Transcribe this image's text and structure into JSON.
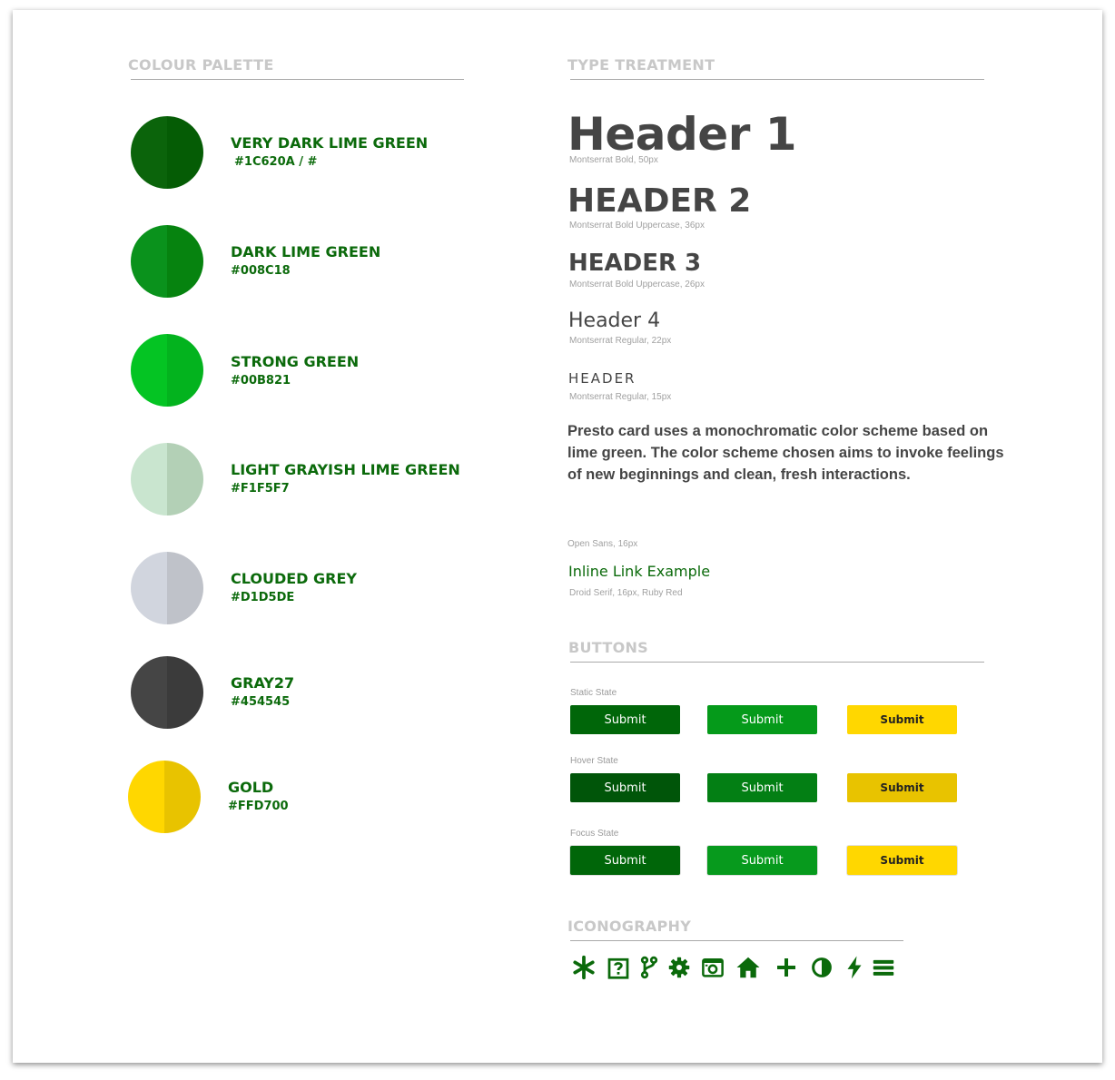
{
  "palette": {
    "title": "COLOUR PALETTE",
    "swatches": [
      {
        "name": "VERY DARK LIME GREEN",
        "hex": "#1C620A / #",
        "color_left": "#0b640b",
        "color_right": "#055c05"
      },
      {
        "name": "DARK LIME GREEN",
        "hex": "#008C18",
        "color_left": "#0a921c",
        "color_right": "#06830f"
      },
      {
        "name": "STRONG GREEN",
        "hex": "#00B821",
        "color_left": "#04c423",
        "color_right": "#03b31e"
      },
      {
        "name": "LIGHT GRAYISH LIME GREEN",
        "hex": "#F1F5F7",
        "color_left": "#c9e5cf",
        "color_right": "#b3d0b6"
      },
      {
        "name": "CLOUDED GREY",
        "hex": "#D1D5DE",
        "color_left": "#d1d5de",
        "color_right": "#bfc2c9"
      },
      {
        "name": "GRAY27",
        "hex": "#454545",
        "color_left": "#454545",
        "color_right": "#3b3b3b"
      },
      {
        "name": "GOLD",
        "hex": "#FFD700",
        "color_left": "#ffd700",
        "color_right": "#e8c300"
      }
    ]
  },
  "type": {
    "title": "TYPE TREATMENT",
    "h1": {
      "sample": "Header 1",
      "caption": "Montserrat Bold, 50px"
    },
    "h2": {
      "sample": "HEADER 2",
      "caption": "Montserrat Bold Uppercase, 36px"
    },
    "h3": {
      "sample": "HEADER 3",
      "caption": "Montserrat Bold Uppercase, 26px"
    },
    "h4": {
      "sample": "Header 4",
      "caption": "Montserrat Regular, 22px"
    },
    "h5": {
      "sample": "HEADER",
      "caption": "Montserrat Regular, 15px"
    },
    "paragraph": "Presto card uses a monochromatic color scheme based on lime green. The color scheme chosen aims to invoke feelings of new beginnings and clean, fresh interactions.",
    "paragraph_caption": "Open Sans, 16px",
    "link": {
      "text": "Inline Link Example",
      "caption": "Droid Serif, 16px, Ruby Red"
    }
  },
  "buttons": {
    "title": "BUTTONS",
    "rows": [
      {
        "state": "Static State",
        "labels": [
          "Submit",
          "Submit",
          "Submit"
        ],
        "colors": [
          "#006609",
          "#059a1a",
          "#ffd700"
        ]
      },
      {
        "state": "Hover State",
        "labels": [
          "Submit",
          "Submit",
          "Submit"
        ],
        "colors": [
          "#005509",
          "#037f14",
          "#e8c300"
        ]
      },
      {
        "state": "Focus State",
        "labels": [
          "Submit",
          "Submit",
          "Submit"
        ],
        "colors": [
          "#006609",
          "#079a1d",
          "#ffd700"
        ]
      }
    ]
  },
  "iconography": {
    "title": "ICONOGRAPHY",
    "icon_color": "#0b6a0b",
    "icons": [
      "asterisk-icon",
      "help-icon",
      "branch-icon",
      "gear-icon",
      "camera-icon",
      "home-icon",
      "plus-icon",
      "contrast-icon",
      "bolt-icon",
      "menu-icon"
    ]
  }
}
